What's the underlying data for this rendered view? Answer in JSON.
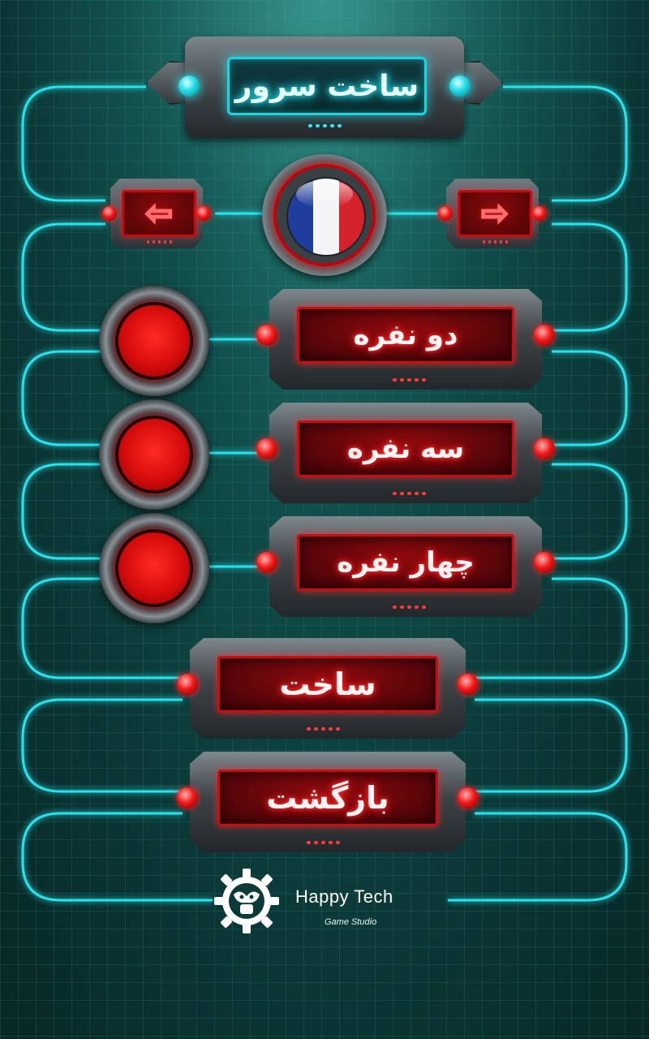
{
  "header": {
    "title": "ساخت سرور"
  },
  "language_selector": {
    "prev_glyph": "⇦",
    "next_glyph": "⇨",
    "flag_colors": [
      "#1f3d9c",
      "#f4f4f6",
      "#d3222a"
    ]
  },
  "player_options": [
    {
      "label": "دو نفره"
    },
    {
      "label": "سه نفره"
    },
    {
      "label": "چهار نفره"
    }
  ],
  "actions": {
    "create_label": "ساخت",
    "back_label": "بازگشت"
  },
  "footer": {
    "studio_name": "Happy Tech",
    "studio_sub": "Game Studio"
  },
  "colors": {
    "accent_cyan": "#1ad5e0",
    "button_red": "#cc0b12",
    "background": "#0f4a47"
  }
}
